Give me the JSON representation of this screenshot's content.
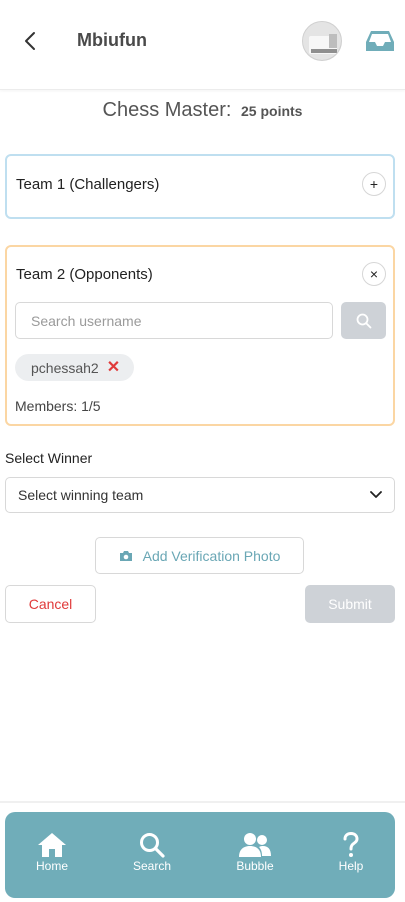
{
  "header": {
    "title": "Mbiufun",
    "back_icon": "chevron-left-icon",
    "inbox_icon": "inbox-icon"
  },
  "game": {
    "name": "Chess Master:",
    "points": "25 points"
  },
  "teams": [
    {
      "name": "Team 1 (Challengers)",
      "action_icon": "plus-icon",
      "action_symbol": "+"
    },
    {
      "name": "Team 2 (Opponents)",
      "action_icon": "close-icon",
      "action_symbol": "×",
      "search_placeholder": "Search username",
      "search_value": "",
      "members": [
        "pchessah2"
      ],
      "member_remove_symbol": "✕",
      "members_count": "Members: 1/5"
    }
  ],
  "winner": {
    "label": "Select Winner",
    "selected": "Select winning team"
  },
  "actions": {
    "photo_label": "Add Verification Photo",
    "cancel_label": "Cancel",
    "submit_label": "Submit"
  },
  "nav": {
    "items": [
      {
        "label": "Home",
        "icon": "home-icon"
      },
      {
        "label": "Search",
        "icon": "search-icon"
      },
      {
        "label": "Bubble",
        "icon": "users-icon"
      },
      {
        "label": "Help",
        "icon": "help-icon"
      }
    ]
  },
  "colors": {
    "accent": "#70adb9",
    "team1_border": "#bfdff0",
    "team2_border": "#fbd6a3",
    "danger": "#e03a3a",
    "disabled": "#ced2d7"
  }
}
